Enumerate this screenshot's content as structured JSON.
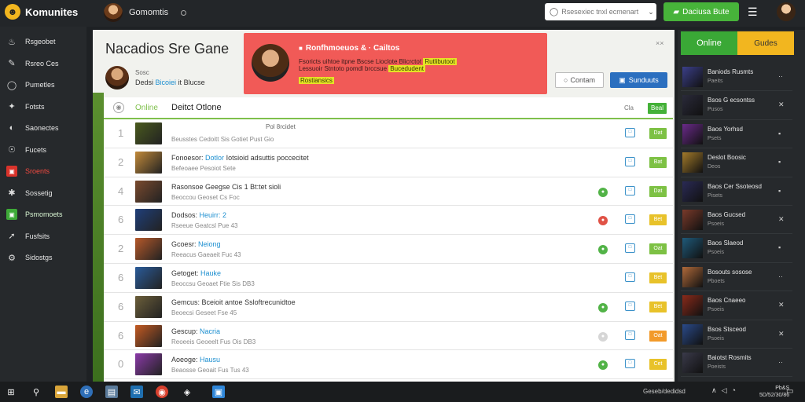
{
  "app": {
    "name": "Komunites",
    "logo_glyph": "☻"
  },
  "topbar": {
    "user_name": "Gomomtis",
    "search_placeholder": "Rsesexiec tnxl ecmenart",
    "cta_label": "Daciusa Bute",
    "cta_icon": "gamepad-icon"
  },
  "sidebar": {
    "items": [
      {
        "label": "Rsgeobet",
        "icon": "fire-icon",
        "glyph": "♨",
        "style": ""
      },
      {
        "label": "Rsreo Ces",
        "icon": "brush-icon",
        "glyph": "✎",
        "style": ""
      },
      {
        "label": "Pumetles",
        "icon": "chat-icon",
        "glyph": "◯",
        "style": ""
      },
      {
        "label": "Fotsts",
        "icon": "puzzle-icon",
        "glyph": "✦",
        "style": ""
      },
      {
        "label": "Saonectes",
        "icon": "speech-icon",
        "glyph": "◐",
        "style": ""
      },
      {
        "label": "Fucets",
        "icon": "globe-icon",
        "glyph": "☉",
        "style": ""
      },
      {
        "label": "Sroents",
        "icon": "flag-icon",
        "glyph": "▣",
        "style": "red"
      },
      {
        "label": "Sossetig",
        "icon": "gear-icon",
        "glyph": "✱",
        "style": ""
      },
      {
        "label": "Psmomoets",
        "icon": "bookmark-icon",
        "glyph": "▣",
        "style": "green"
      },
      {
        "label": "Fusfsits",
        "icon": "arrow-icon",
        "glyph": "➚",
        "style": ""
      },
      {
        "label": "Sidostgs",
        "icon": "settings-icon",
        "glyph": "⚙",
        "style": ""
      }
    ]
  },
  "page": {
    "title": "Nacadios Sre Gane",
    "profile_sub": "Sosc",
    "profile_name_prefix": "Dedsi",
    "profile_name_highlight": "Bicoiei",
    "profile_name_suffix": "it Blucse"
  },
  "alert": {
    "title": "Ronfhmoeuos & · Cailtos",
    "line1": "Fsoricts uihtoe itpne Bscse Lioclote Blicrctot",
    "line1_highlight": "Rutlibutoot",
    "line2_prefix": "Lessuoir Stntoto pomdl brccsue",
    "line2_highlight": "Bucedudent",
    "line3": "Rostiansics",
    "close": "××"
  },
  "actions": {
    "outline_label": "Contam",
    "outline_icon": "refresh-icon",
    "blue_label": "Sunduuts",
    "blue_icon": "inbox-icon"
  },
  "list": {
    "online_label": "Online",
    "title": "Deitct Otlone",
    "col_label": "Cla",
    "badge_label": "Beal",
    "rows": [
      {
        "num": "1",
        "title": "",
        "title_hl": "",
        "title_suffix": "",
        "sub": "Beusstes Cedoitt Sis Gotiet Pust Gio",
        "meta": "Pol 8rcidet",
        "status": "",
        "badge": "Dat",
        "badge_color": "#7dc144",
        "thumb": "#4a5a1e"
      },
      {
        "num": "2",
        "title": "Fonoesor:",
        "title_hl": "Dotlor",
        "title_suffix": "Iotsioid adsuttis poccecitet",
        "sub": "Befeoaee Pesoiot Sete",
        "meta": "",
        "status": "",
        "badge": "Bat",
        "badge_color": "#7dc144",
        "thumb": "#c28a3a"
      },
      {
        "num": "4",
        "title": "Rasonsoe Geegse Cis",
        "title_hl": "",
        "title_suffix": "1 Bt:tet sioli",
        "sub": "Beoccou Geoset Cs Foc",
        "meta": "",
        "status": "#52b347",
        "badge": "Dat",
        "badge_color": "#7dc144",
        "thumb": "#7a4a2e"
      },
      {
        "num": "6",
        "title": "Dodsos:",
        "title_hl": "Heuirr: 2",
        "title_suffix": "",
        "sub": "Rseeue Geatcsl Pue 43",
        "meta": "",
        "status": "#e05246",
        "badge": "Bet",
        "badge_color": "#e8c22a",
        "thumb": "#1f3f7a"
      },
      {
        "num": "2",
        "title": "Gcoesr:",
        "title_hl": "Neiong",
        "title_suffix": "",
        "sub": "Reeacus Gaeaeit Fuc 43",
        "meta": "",
        "status": "#52b347",
        "badge": "Oat",
        "badge_color": "#7dc144",
        "thumb": "#b7592a"
      },
      {
        "num": "6",
        "title": "Getoget:",
        "title_hl": "Hauke",
        "title_suffix": "",
        "sub": "Beoccsu Geoaet Ftie Sis DB3",
        "meta": "",
        "status": "",
        "badge": "Bet",
        "badge_color": "#e8c22a",
        "thumb": "#2a5b9a"
      },
      {
        "num": "6",
        "title": "Gemcus:",
        "title_hl": "",
        "title_suffix": "Bceioit antoe Ssloftrecunidtoe",
        "sub": "Beoecsi Geseet Fse 45",
        "meta": "",
        "status": "#52b347",
        "badge": "Bet",
        "badge_color": "#e8c22a",
        "thumb": "#6b5e3a"
      },
      {
        "num": "6",
        "title": "Gescup:",
        "title_hl": "Nacria",
        "title_suffix": "",
        "sub": "Reoeeis Geoeelt Fus Ois DB3",
        "meta": "",
        "status": "#d6d6d6",
        "badge": "Oat",
        "badge_color": "#f29a2a",
        "thumb": "#c45a22"
      },
      {
        "num": "0",
        "title": "Aoeoge:",
        "title_hl": "Hausu",
        "title_suffix": "",
        "sub": "Beaosse Geoait Fus Tus 43",
        "meta": "",
        "status": "#52b347",
        "badge": "Cet",
        "badge_color": "#e8c22a",
        "thumb": "#8a3aa8"
      }
    ]
  },
  "right_panel": {
    "tab_online": "Online",
    "tab_guides": "Gudes",
    "items": [
      {
        "title": "Baniods Rusmts",
        "sub": "Paeits",
        "act": "··",
        "thumb": "#3b3f8a"
      },
      {
        "title": "Bsos G ecsontss",
        "sub": "Pusos",
        "act": "✕",
        "thumb": "#2a2a3a"
      },
      {
        "title": "Baos Yorhsd",
        "sub": "Psets",
        "act": "▪",
        "thumb": "#6a2a8a"
      },
      {
        "title": "Deslot Boosic",
        "sub": "Deos",
        "act": "▪",
        "thumb": "#a37a2a"
      },
      {
        "title": "Baos Cer Ssoteosd",
        "sub": "Pisets",
        "act": "▪",
        "thumb": "#2a2a55"
      },
      {
        "title": "Baos Gucsed",
        "sub": "Psoeis",
        "act": "✕",
        "thumb": "#7a3a2a"
      },
      {
        "title": "Baos Slaeod",
        "sub": "Psoeis",
        "act": "▪",
        "thumb": "#1f5a7a"
      },
      {
        "title": "Bosouts sosose",
        "sub": "Pboets",
        "act": "··",
        "thumb": "#b06a3a"
      },
      {
        "title": "Baos Cnaeeo",
        "sub": "Psoeis",
        "act": "✕",
        "thumb": "#8a2a1a"
      },
      {
        "title": "Bsos Stsceod",
        "sub": "Psoeis",
        "act": "✕",
        "thumb": "#2a4a8a"
      },
      {
        "title": "Baiotst Rosmits",
        "sub": "Poeists",
        "act": "··",
        "thumb": "#3a3a4a"
      }
    ]
  },
  "taskbar": {
    "tray_text": "Geseb/dedidsd",
    "clock_time": "Pb&S",
    "clock_date": "5D/52/30/86"
  }
}
